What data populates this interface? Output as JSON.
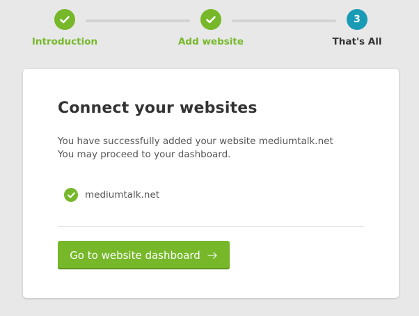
{
  "stepper": {
    "steps": [
      {
        "label": "Introduction",
        "status": "complete",
        "icon": "checkmark-icon"
      },
      {
        "label": "Add website",
        "status": "complete",
        "icon": "checkmark-icon"
      },
      {
        "label": "That's All",
        "status": "current",
        "number": "3"
      }
    ],
    "colors": {
      "complete": "#76b82a",
      "current": "#1a9bb5",
      "connector": "#d3d3d3"
    }
  },
  "card": {
    "title": "Connect your websites",
    "message_line1": "You have successfully added your website mediumtalk.net",
    "message_line2": "You may proceed to your dashboard.",
    "site": {
      "name": "mediumtalk.net",
      "icon": "checkmark-icon"
    },
    "button": {
      "label": "Go to website dashboard",
      "icon": "arrow-right-icon"
    },
    "colors": {
      "accent": "#76b82a"
    }
  }
}
